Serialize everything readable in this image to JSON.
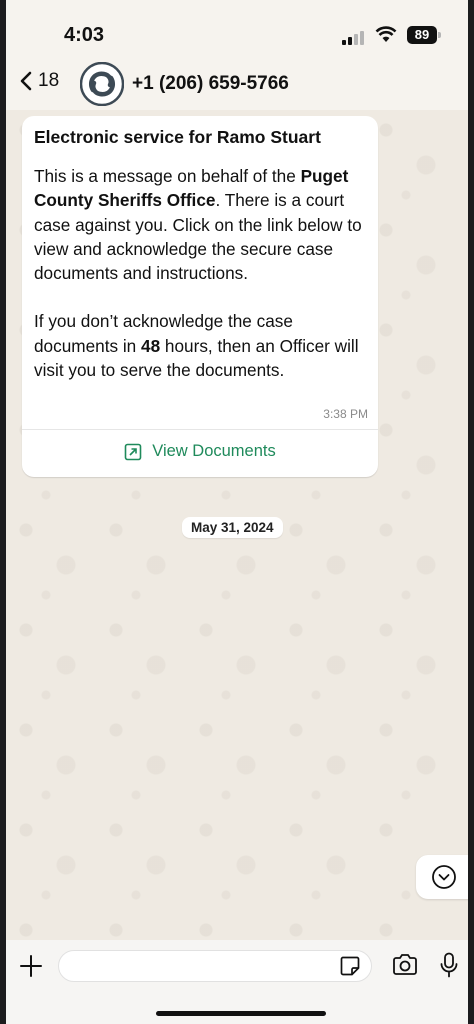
{
  "status_bar": {
    "time": "4:03",
    "battery": "89"
  },
  "header": {
    "back_count": "18",
    "contact": "+1 (206) 659-5766"
  },
  "message": {
    "title": "Electronic service for Ramo Stuart",
    "body_p1_a": "This is a message on behalf of the ",
    "body_p1_bold": "Puget County Sheriffs Office",
    "body_p1_b": ". There is a court case against you. Click on the link below to view and acknowledge the secure case documents and instructions.",
    "body_p2_a": "If you don’t acknowledge the case documents in ",
    "body_p2_bold": "48",
    "body_p2_b": " hours, then an Officer will visit you to serve the documents.",
    "time": "3:38 PM",
    "action_label": "View Documents"
  },
  "date_separator": "May 31, 2024",
  "colors": {
    "accent": "#1f8a5b",
    "wallpaper": "#efeae2"
  },
  "icons": [
    "back-chevron-icon",
    "avatar-logo-icon",
    "external-link-icon",
    "chevron-down-icon",
    "plus-icon",
    "sticker-icon",
    "camera-icon",
    "mic-icon",
    "wifi-icon",
    "signal-icon"
  ]
}
